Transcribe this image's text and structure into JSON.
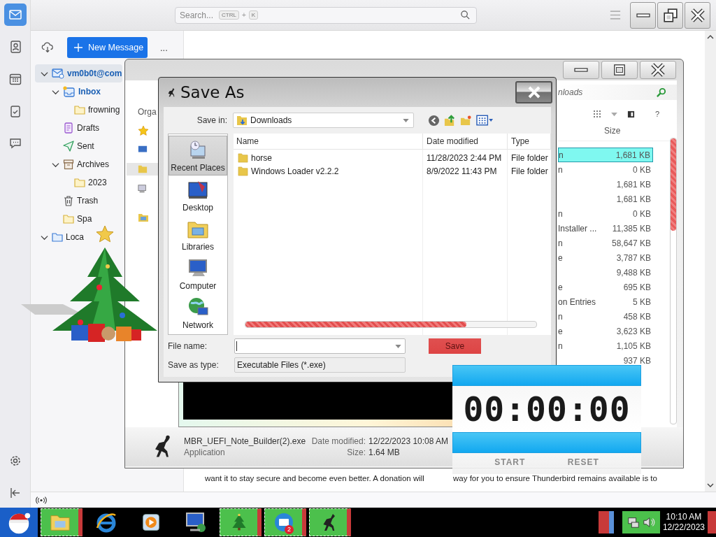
{
  "thunderbird": {
    "search": {
      "placeholder": "Search...",
      "shortcut": [
        "CTRL",
        "+",
        "K"
      ]
    },
    "spaces": [
      {
        "kind": "mail",
        "selected": true
      },
      {
        "kind": "contacts",
        "selected": false
      },
      {
        "kind": "calendar",
        "selected": false
      },
      {
        "kind": "tasks",
        "selected": false
      },
      {
        "kind": "chat",
        "selected": false
      }
    ],
    "new_message_button": "New Message",
    "more_button": "...",
    "folders": [
      {
        "label": "vm0b0t@com",
        "kind": "account",
        "selected": true,
        "new_mail": false,
        "expanded": true,
        "children": [
          {
            "label": "Inbox",
            "kind": "inbox",
            "selected": false,
            "new_mail": true,
            "expanded": true,
            "children": [
              {
                "label": "frowning",
                "kind": "folder",
                "selected": false,
                "new_mail": false
              }
            ]
          },
          {
            "label": "Drafts",
            "kind": "drafts",
            "selected": false,
            "new_mail": false
          },
          {
            "label": "Sent",
            "kind": "sent",
            "selected": false,
            "new_mail": false
          },
          {
            "label": "Archives",
            "kind": "archive",
            "selected": false,
            "new_mail": false,
            "expanded": true,
            "children": [
              {
                "label": "2023",
                "kind": "folder",
                "selected": false,
                "new_mail": false
              }
            ]
          },
          {
            "label": "Trash",
            "kind": "trash",
            "selected": false,
            "new_mail": false
          },
          {
            "label": "Spa",
            "kind": "folder",
            "selected": false,
            "new_mail": false
          }
        ]
      },
      {
        "label": "Loca",
        "kind": "local",
        "selected": false,
        "new_mail": false,
        "expanded": true
      }
    ],
    "message_text": {
      "left": "want it to stay secure and become even better. A donation will",
      "right": "way for you to ensure Thunderbird remains available is to"
    }
  },
  "explorer": {
    "organize": "Orga",
    "search_placeholder": "nloads",
    "help": "?",
    "size_header": "Size",
    "rows": [
      {
        "type": "n",
        "size": "1,681 KB",
        "selected": true
      },
      {
        "type": "n",
        "size": "0 KB",
        "selected": false
      },
      {
        "size": "1,681 KB",
        "selected": false
      },
      {
        "size": "1,681 KB",
        "selected": false
      },
      {
        "type": "n",
        "size": "0 KB",
        "selected": false
      },
      {
        "type": "Installer ...",
        "size": "11,385 KB",
        "selected": false
      },
      {
        "type": "n",
        "size": "58,647 KB",
        "selected": false
      },
      {
        "type": "e",
        "size": "3,787 KB",
        "selected": false
      },
      {
        "size": "9,488 KB",
        "selected": false
      },
      {
        "type": "e",
        "size": "695 KB",
        "selected": false
      },
      {
        "type": "on Entries",
        "size": "5 KB",
        "selected": false
      },
      {
        "type": "n",
        "size": "458 KB",
        "selected": false
      },
      {
        "type": "e",
        "size": "3,623 KB",
        "selected": false
      },
      {
        "type": "n",
        "size": "1,105 KB",
        "selected": false
      },
      {
        "size": "937 KB",
        "selected": false
      }
    ],
    "details": {
      "file_name": "MBR_UEFI_Note_Builder(2).exe",
      "file_type": "Application",
      "date_label": "Date modified:",
      "date": "12/22/2023 10:08 AM",
      "size_label": "Size:",
      "size": "1.64 MB"
    }
  },
  "save_dialog": {
    "title": "Save As",
    "save_in_label": "Save in:",
    "save_in": "Downloads",
    "places": [
      {
        "label": "Recent Places",
        "kind": "recent",
        "selected": true
      },
      {
        "label": "Desktop",
        "kind": "desktop",
        "selected": false
      },
      {
        "label": "Libraries",
        "kind": "libraries",
        "selected": false
      },
      {
        "label": "Computer",
        "kind": "computer",
        "selected": false
      },
      {
        "label": "Network",
        "kind": "network",
        "selected": false
      }
    ],
    "columns": [
      "Name",
      "Date modified",
      "Type"
    ],
    "files": [
      {
        "name": "horse",
        "date": "11/28/2023 2:44 PM",
        "type": "File folder"
      },
      {
        "name": "Windows Loader v2.2.2",
        "date": "8/9/2022 11:43 PM",
        "type": "File folder"
      }
    ],
    "progress": {
      "level": 0.76
    },
    "file_name_label": "File name:",
    "save_type_label": "Save as type:",
    "save_type": "Executable Files (*.exe)",
    "save_button": "Save"
  },
  "timer": {
    "display": "00:00:00",
    "buttons": [
      "START",
      "RESET"
    ]
  },
  "taskbar": {
    "items": [
      {
        "kind": "explorer",
        "active": true
      },
      {
        "kind": "browser",
        "active": false
      },
      {
        "kind": "media",
        "active": false
      },
      {
        "kind": "remote",
        "active": false
      },
      {
        "kind": "tree",
        "active": true
      },
      {
        "kind": "mail",
        "active": true,
        "badge": "2"
      },
      {
        "kind": "dancer",
        "active": true
      }
    ],
    "clock": {
      "time": "10:10 AM",
      "date": "12/22/2023"
    }
  }
}
